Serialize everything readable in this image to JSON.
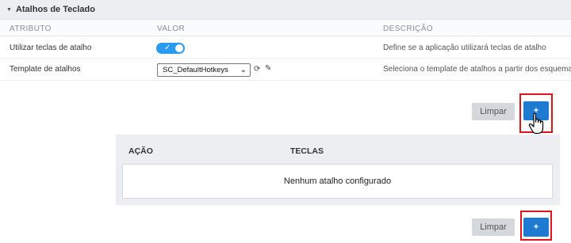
{
  "panel": {
    "title": "Atalhos de Teclado"
  },
  "columns": {
    "attribute": "ATRIBUTO",
    "value": "VALOR",
    "description": "DESCRIÇÃO"
  },
  "rows": [
    {
      "label": "Utilizar teclas de atalho",
      "toggle_on": true,
      "description": "Define se a aplicação utilizará teclas de atalho"
    },
    {
      "label": "Template de atalhos",
      "selected": "SC_DefaultHotkeys",
      "description": "Seleciona o template de atalhos a partir dos esquemas"
    }
  ],
  "buttons": {
    "clear_label": "Limpar",
    "add_label": "+"
  },
  "shortcuts_table": {
    "col_action": "AÇÃO",
    "col_keys": "TECLAS",
    "empty_message": "Nenhum atalho configurado"
  },
  "colors": {
    "accent": "#1f7bd1",
    "toggle": "#2b9af3",
    "highlight": "#e0141e"
  }
}
